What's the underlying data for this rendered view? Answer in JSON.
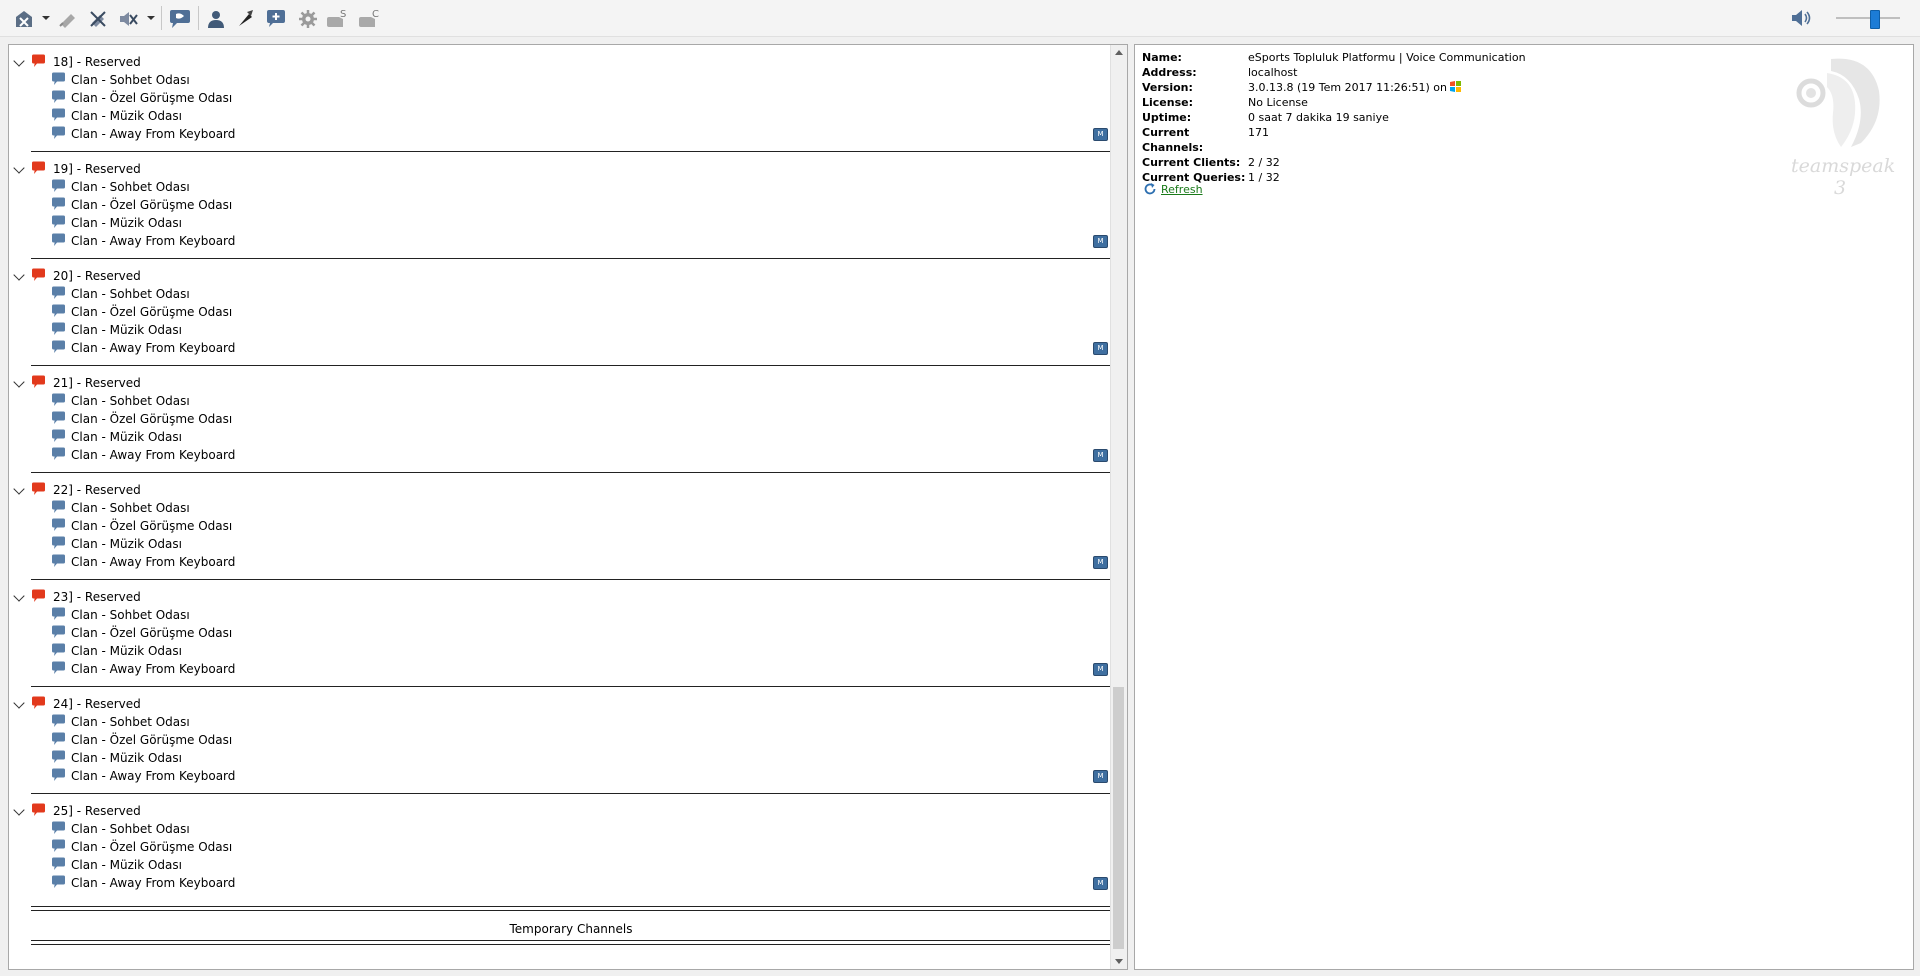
{
  "toolbar": {
    "buttons": [
      {
        "name": "disconnect-icon",
        "has_dropdown": true
      },
      {
        "name": "bookmark-icon"
      },
      {
        "name": "mute-microphone-icon"
      },
      {
        "name": "mute-speakers-icon",
        "has_dropdown": true
      },
      {
        "name": "chat-icon"
      },
      {
        "name": "contacts-icon"
      },
      {
        "name": "away-icon"
      },
      {
        "name": "add-channel-icon"
      },
      {
        "name": "settings-icon"
      },
      {
        "name": "server-query-icon"
      },
      {
        "name": "client-query-icon"
      }
    ],
    "volume_level": 0.55
  },
  "tree": {
    "groups": [
      {
        "title": "18] - Reserved",
        "children": [
          "Clan - Sohbet Odası",
          "Clan - Özel Görüşme Odası",
          "Clan - Müzik Odası",
          "Clan - Away From Keyboard"
        ]
      },
      {
        "title": "19] - Reserved",
        "children": [
          "Clan - Sohbet Odası",
          "Clan - Özel Görüşme Odası",
          "Clan - Müzik Odası",
          "Clan - Away From Keyboard"
        ]
      },
      {
        "title": "20] - Reserved",
        "children": [
          "Clan - Sohbet Odası",
          "Clan - Özel Görüşme Odası",
          "Clan - Müzik Odası",
          "Clan - Away From Keyboard"
        ]
      },
      {
        "title": "21] - Reserved",
        "children": [
          "Clan - Sohbet Odası",
          "Clan - Özel Görüşme Odası",
          "Clan - Müzik Odası",
          "Clan - Away From Keyboard"
        ]
      },
      {
        "title": "22] - Reserved",
        "children": [
          "Clan - Sohbet Odası",
          "Clan - Özel Görüşme Odası",
          "Clan - Müzik Odası",
          "Clan - Away From Keyboard"
        ]
      },
      {
        "title": "23] - Reserved",
        "children": [
          "Clan - Sohbet Odası",
          "Clan - Özel Görüşme Odası",
          "Clan - Müzik Odası",
          "Clan - Away From Keyboard"
        ]
      },
      {
        "title": "24] - Reserved",
        "children": [
          "Clan - Sohbet Odası",
          "Clan - Özel Görüşme Odası",
          "Clan - Müzik Odası",
          "Clan - Away From Keyboard"
        ]
      },
      {
        "title": "25] - Reserved",
        "children": [
          "Clan - Sohbet Odası",
          "Clan - Özel Görüşme Odası",
          "Clan - Müzik Odası",
          "Clan - Away From Keyboard"
        ]
      }
    ],
    "temporary_label": "Temporary Channels"
  },
  "info": {
    "rows": [
      {
        "key": "Name:",
        "value": "eSports Topluluk Platformu | Voice Communication"
      },
      {
        "key": "Address:",
        "value": "localhost"
      },
      {
        "key": "Version:",
        "value": "3.0.13.8 (19 Tem 2017 11:26:51) on"
      },
      {
        "key": "License:",
        "value": "No License"
      },
      {
        "key": "Uptime:",
        "value": "0 saat 7 dakika 19 saniye"
      },
      {
        "key": "Current Channels:",
        "value": "171"
      },
      {
        "key": "Current Clients:",
        "value": "2 / 32"
      },
      {
        "key": "Current Queries:",
        "value": "1 / 32"
      }
    ],
    "refresh_label": "Refresh",
    "logo_text": "teamspeak 3"
  },
  "colors": {
    "accent": "#1c7cd6",
    "channel_red": "#e2391c",
    "channel_blue": "#5a7fa8",
    "link_green": "#1a7a1a"
  }
}
